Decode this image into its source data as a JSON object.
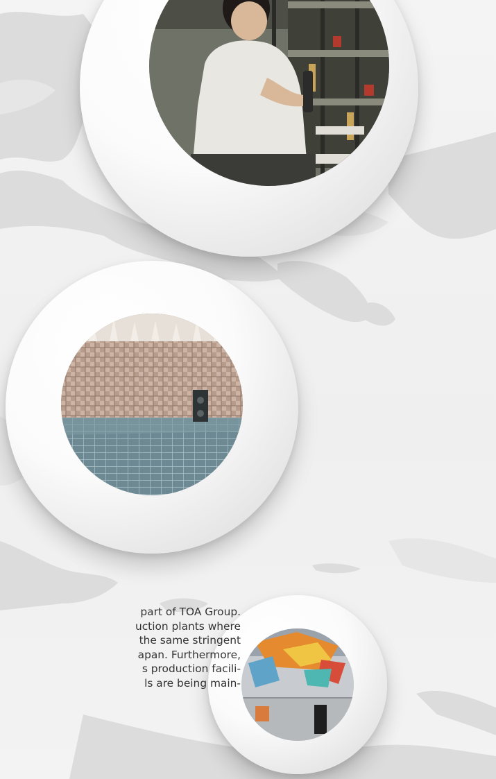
{
  "body_text": {
    "lines": [
      "part of TOA Group.",
      "uction plants where",
      "the same stringent",
      "apan. Furthermore,",
      "s production facili-",
      "ls are being main-"
    ]
  },
  "colors": {
    "background": "#f2f2f2",
    "map": "#d9d9d9",
    "ring_white": "#ffffff",
    "text": "#333333"
  },
  "photos": [
    {
      "subject": "factory worker at assembly line",
      "icon": "photo-factory-worker"
    },
    {
      "subject": "anechoic acoustic test chamber",
      "icon": "photo-anechoic-chamber"
    },
    {
      "subject": "colorful test room with speaker",
      "icon": "photo-test-room"
    }
  ]
}
